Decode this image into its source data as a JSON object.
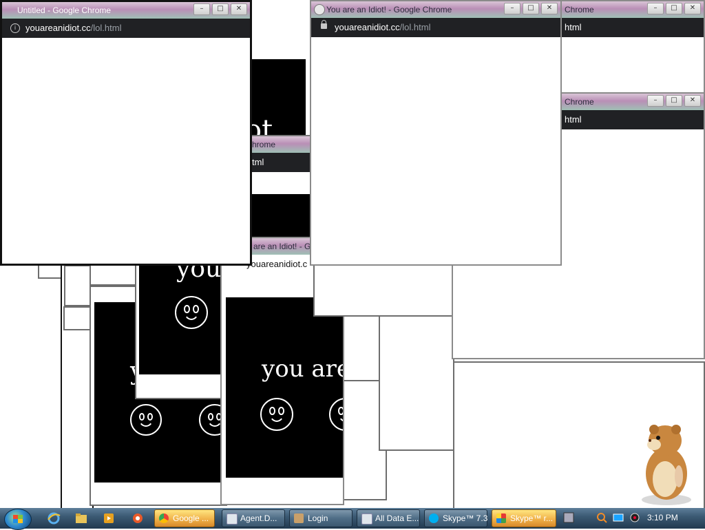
{
  "windows": {
    "left": {
      "title": "Untitled - Google Chrome",
      "url_host": "youareanidiot.cc",
      "url_path": "/lol.html"
    },
    "center": {
      "title": "You are an Idiot! - Google Chrome",
      "url_host": "youareanidiot.cc",
      "url_path": "/lol.html"
    },
    "right_top": {
      "title": "Chrome",
      "url_fragment": "html"
    },
    "right_mid": {
      "title": "Chrome",
      "url_fragment": "html"
    },
    "behind_mid": {
      "title": "hrome",
      "url_fragment": "tml"
    },
    "behind_low": {
      "title": "are an Idiot! - G",
      "url_host": "youareanidiot.c"
    }
  },
  "idiot_text": {
    "big_left": "ot",
    "mid_left": "you",
    "lower_left": "y",
    "center": "you are"
  },
  "window_controls": {
    "minimize": "–",
    "maximize": "□",
    "close": "✕"
  },
  "taskbar": {
    "buttons": [
      {
        "label": "Google ...",
        "highlighted": true
      },
      {
        "label": "Agent.D...",
        "highlighted": false
      },
      {
        "label": "Login",
        "highlighted": false
      },
      {
        "label": "All Data E...",
        "highlighted": false
      },
      {
        "label": "Skype™ 7.3",
        "highlighted": false
      },
      {
        "label": "Skype™ r...",
        "highlighted": true
      }
    ],
    "clock": "3:10 PM"
  },
  "colors": {
    "chrome_bar": "#202124",
    "taskbar": "#3c5a74",
    "highlight": "#f0b24a"
  }
}
